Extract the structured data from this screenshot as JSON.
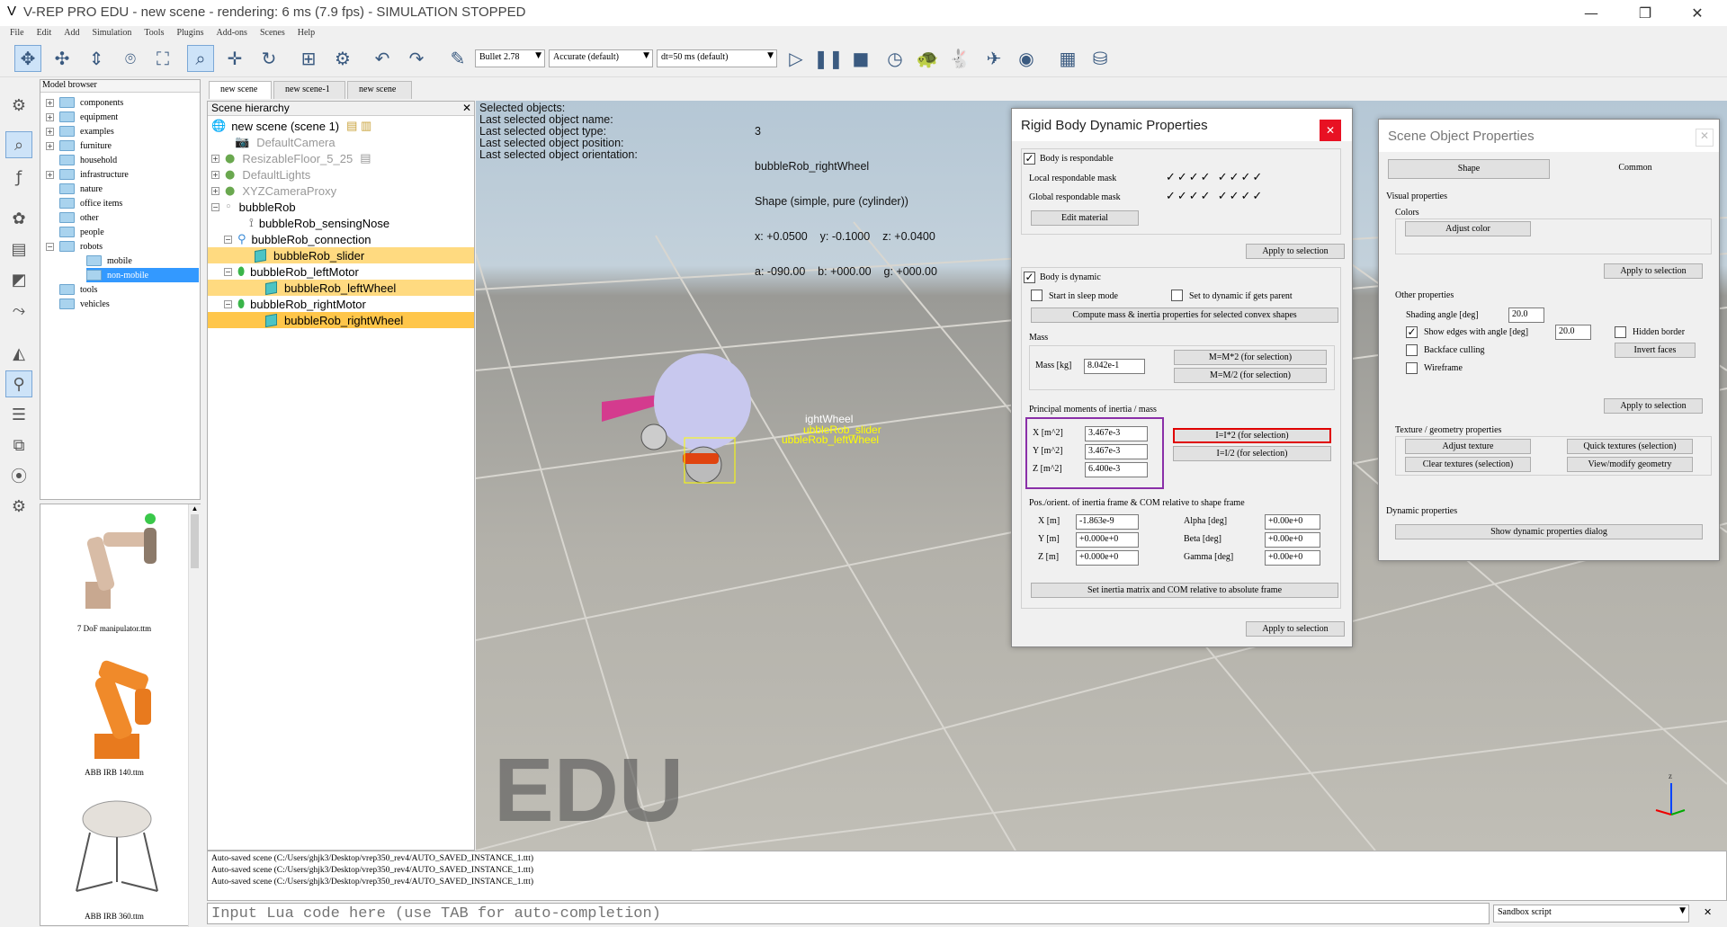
{
  "window": {
    "logo": "V",
    "title": "V-REP PRO EDU - new scene - rendering: 6 ms (7.9 fps) - SIMULATION STOPPED",
    "min": "—",
    "max": "❐",
    "close": "✕"
  },
  "menu": [
    "File",
    "Edit",
    "Add",
    "Simulation",
    "Tools",
    "Plugins",
    "Add-ons",
    "Scenes",
    "Help"
  ],
  "toolbar": {
    "engine": "Bullet 2.78",
    "accuracy": "Accurate (default)",
    "dt": "dt=50 ms (default)"
  },
  "model_browser": {
    "title": "Model browser",
    "folders": [
      "components",
      "equipment",
      "examples",
      "furniture",
      "household",
      "infrastructure",
      "nature",
      "office items",
      "other",
      "people",
      "robots",
      "mobile",
      "non-mobile",
      "tools",
      "vehicles"
    ],
    "thumbs": [
      "7 DoF manipulator.ttm",
      "ABB IRB 140.ttm",
      "ABB IRB 360.ttm"
    ]
  },
  "scene_tabs": [
    "new scene",
    "new scene-1",
    "new scene"
  ],
  "hierarchy": {
    "title": "Scene hierarchy",
    "close": "✕",
    "items": [
      "new scene (scene 1)",
      "DefaultCamera",
      "ResizableFloor_5_25",
      "DefaultLights",
      "XYZCameraProxy",
      "bubbleRob",
      "bubbleRob_sensingNose",
      "bubbleRob_connection",
      "bubbleRob_slider",
      "bubbleRob_leftMotor",
      "bubbleRob_leftWheel",
      "bubbleRob_rightMotor",
      "bubbleRob_rightWheel"
    ]
  },
  "info": {
    "labels": [
      "Selected objects:",
      "Last selected object name:",
      "Last selected object type:",
      "Last selected object position:",
      "Last selected object orientation:"
    ],
    "values": [
      "3",
      "bubbleRob_rightWheel",
      "Shape (simple, pure (cylinder))",
      "x: +0.0500    y: -0.1000    z: +0.0400",
      "a: -090.00    b: +000.00    g: +000.00"
    ]
  },
  "viewport": {
    "watermark": "EDU",
    "labels": [
      "ightWheel",
      "ubbleRob_slider",
      "ubbleRob_leftWheel"
    ]
  },
  "rigid": {
    "title": "Rigid Body Dynamic Properties",
    "close": "✕",
    "respondable": "Body is respondable",
    "local_mask": "Local respondable mask",
    "global_mask": "Global respondable mask",
    "checks": "✓✓✓✓ ✓✓✓✓",
    "edit_material": "Edit material",
    "apply": "Apply to selection",
    "dynamic": "Body is dynamic",
    "sleep": "Start in sleep mode",
    "set_dynamic": "Set to dynamic if gets parent",
    "compute": "Compute mass & inertia properties for selected convex shapes",
    "mass_title": "Mass",
    "mass_label": "Mass [kg]",
    "mass_value": "8.042e-1",
    "mass_x2": "M=M*2  (for selection)",
    "mass_d2": "M=M/2  (for selection)",
    "inertia_title": "Principal moments of inertia / mass",
    "ix_l": "X [m^2]",
    "ix": "3.467e-3",
    "iy_l": "Y [m^2]",
    "iy": "3.467e-3",
    "iz_l": "Z [m^2]",
    "iz": "6.400e-3",
    "i_x2": "I=I*2  (for selection)",
    "i_d2": "I=I/2  (for selection)",
    "frame_title": "Pos./orient. of inertia frame & COM relative to shape frame",
    "px_l": "X [m]",
    "px": "-1.863e-9",
    "py_l": "Y [m]",
    "py": "+0.000e+0",
    "pz_l": "Z [m]",
    "pz": "+0.000e+0",
    "al": "Alpha [deg]",
    "a": "+0.00e+0",
    "bl": "Beta [deg]",
    "b": "+0.00e+0",
    "gl": "Gamma [deg]",
    "g": "+0.00e+0",
    "set_abs": "Set inertia matrix and COM relative to absolute frame"
  },
  "sop": {
    "title": "Scene Object Properties",
    "tab_shape": "Shape",
    "tab_common": "Common",
    "visual": "Visual properties",
    "colors": "Colors",
    "adjust_color": "Adjust color",
    "apply": "Apply to selection",
    "other": "Other properties",
    "shading": "Shading angle [deg]",
    "shading_v": "20.0",
    "edges": "Show edges with angle [deg]",
    "edges_v": "20.0",
    "hidden": "Hidden border",
    "backface": "Backface culling",
    "invert": "Invert faces",
    "wire": "Wireframe",
    "texture_title": "Texture / geometry properties",
    "adjust_tex": "Adjust texture",
    "quick_tex": "Quick textures (selection)",
    "clear_tex": "Clear textures (selection)",
    "view_geom": "View/modify geometry",
    "dyn": "Dynamic properties",
    "show_dyn": "Show dynamic properties dialog"
  },
  "console": {
    "lines": [
      "Auto-saved scene (C:/Users/ghjk3/Desktop/vrep350_rev4/AUTO_SAVED_INSTANCE_1.ttt)",
      "Auto-saved scene (C:/Users/ghjk3/Desktop/vrep350_rev4/AUTO_SAVED_INSTANCE_1.ttt)",
      "Auto-saved scene (C:/Users/ghjk3/Desktop/vrep350_rev4/AUTO_SAVED_INSTANCE_1.ttt)"
    ],
    "placeholder": "Input Lua code here (use TAB for auto-completion)",
    "script": "Sandbox script"
  }
}
